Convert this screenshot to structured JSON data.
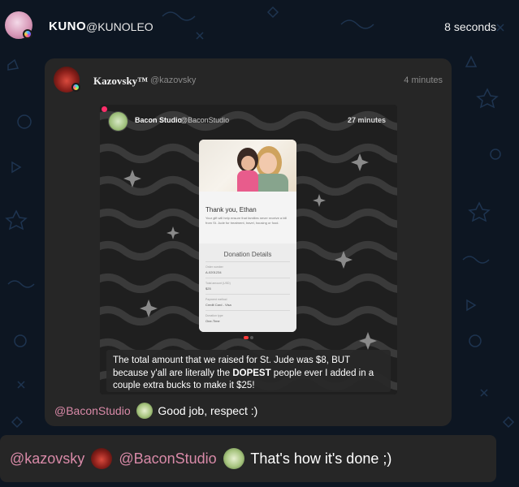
{
  "header": {
    "display_name": "KUNO",
    "handle": "@KUNOLEO",
    "timestamp": "8 seconds"
  },
  "quoted_post": {
    "display_name": "Kazovsky™",
    "handle": "@kazovsky",
    "timestamp": "4 minutes",
    "inner_post": {
      "display_name": "Bacon Studio",
      "handle": "@BaconStudio",
      "timestamp": "27 minutes",
      "donation_card": {
        "thanks": "Thank you, Ethan",
        "body": "Your gift will help ensure that families never receive a bill from St. Jude for treatment, travel, housing or food.",
        "details_title": "Donation Details",
        "fields": [
          {
            "label": "Order number",
            "value": "A-0201234"
          },
          {
            "label": "Total amount (USD)",
            "value": "$25"
          },
          {
            "label": "Payment method",
            "value": "Credit Card - Visa"
          },
          {
            "label": "Donation type",
            "value": "One-Time"
          }
        ]
      },
      "caption_part1": "The total amount that we raised for St. Jude was $8, BUT because y'all are literally the ",
      "caption_bold": "DOPEST",
      "caption_part2": " people ever I added in a couple extra bucks to make it $25!"
    },
    "footer": {
      "mention": "@BaconStudio",
      "text": "Good job, respect :)"
    }
  },
  "reply": {
    "mention1": "@kazovsky",
    "mention2": "@BaconStudio",
    "text": "That's how it's done ;)"
  },
  "colors": {
    "background": "#0d1622",
    "card": "#262626",
    "mention": "#d98aa8"
  }
}
